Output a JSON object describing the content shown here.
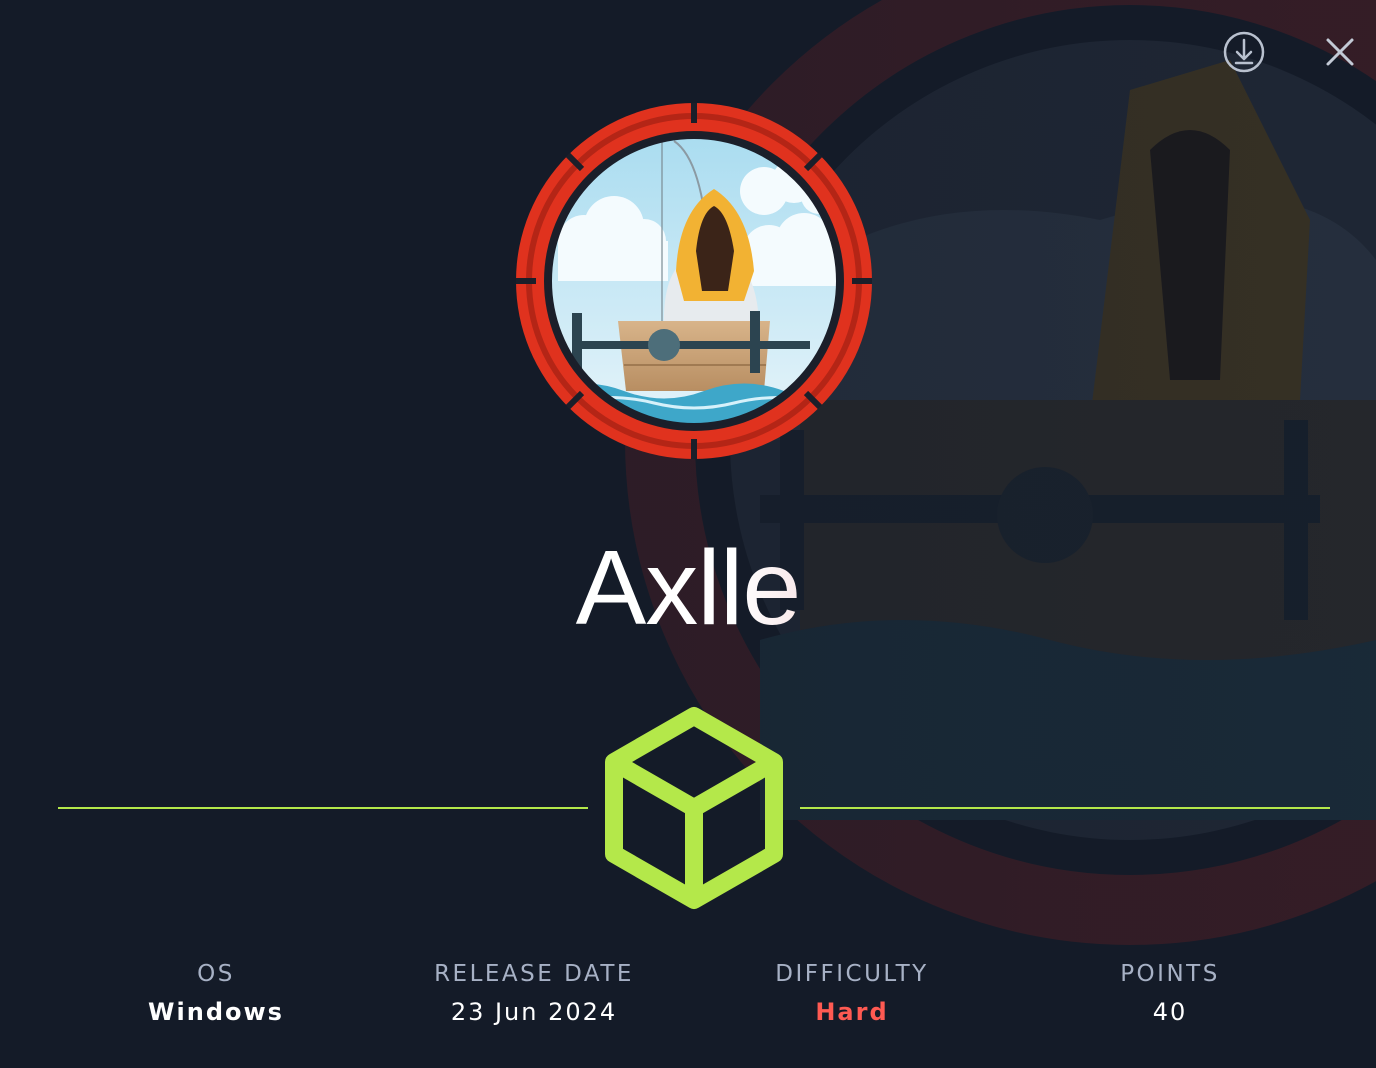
{
  "header": {
    "download_icon": "download-circle-icon",
    "close_icon": "close-icon"
  },
  "machine": {
    "name": "Axlle",
    "avatar_icon": "fisherman-in-boat-avatar",
    "badge_icon": "cube-icon"
  },
  "stats": {
    "os": {
      "label": "OS",
      "value": "Windows"
    },
    "release_date": {
      "label": "RELEASE DATE",
      "value": "23 Jun 2024"
    },
    "difficulty": {
      "label": "DIFFICULTY",
      "value": "Hard"
    },
    "points": {
      "label": "POINTS",
      "value": "40"
    }
  },
  "colors": {
    "background": "#141b28",
    "accent_green": "#b4e84a",
    "difficulty_hard": "#ff5a52",
    "ring_red": "#e0321e",
    "label_gray": "#a7b1c5"
  }
}
